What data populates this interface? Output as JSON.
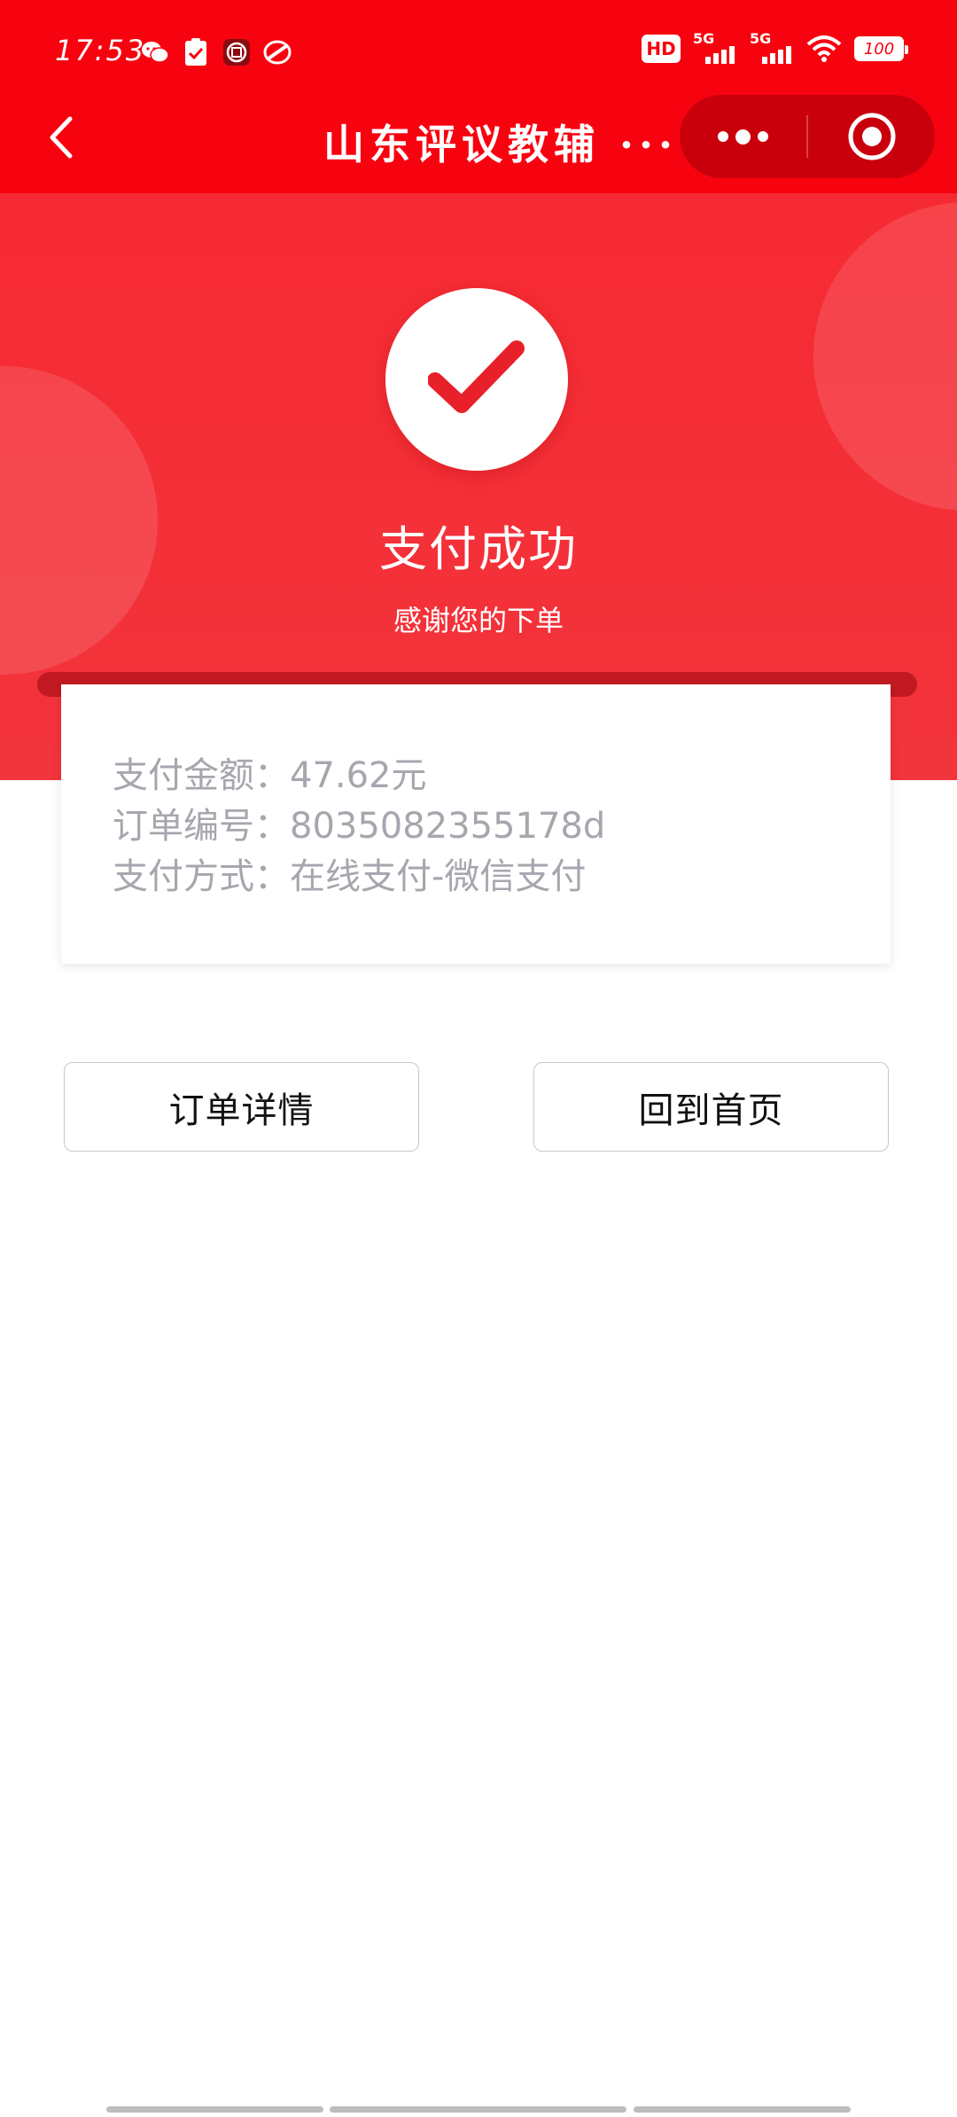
{
  "status_bar": {
    "time": "17:53",
    "left_icons": [
      "wechat-icon",
      "task-check-icon",
      "bank-icon",
      "swirl-app-icon"
    ],
    "hd_label": "HD",
    "network_1": "5G",
    "network_2": "5G",
    "battery": "100"
  },
  "nav": {
    "title": "山东评议教辅 ···"
  },
  "success": {
    "title": "支付成功",
    "subtitle": "感谢您的下单"
  },
  "order": {
    "amount": "支付金额：47.62元",
    "number": "订单编号：8035082355178d",
    "method": "支付方式：在线支付-微信支付"
  },
  "actions": {
    "detail_label": "订单详情",
    "home_label": "回到首页"
  },
  "colors": {
    "primary_red": "#f7030f",
    "capsule_red": "#c9000b",
    "check_red": "#e8202a",
    "muted_text": "#a5a7ae"
  }
}
